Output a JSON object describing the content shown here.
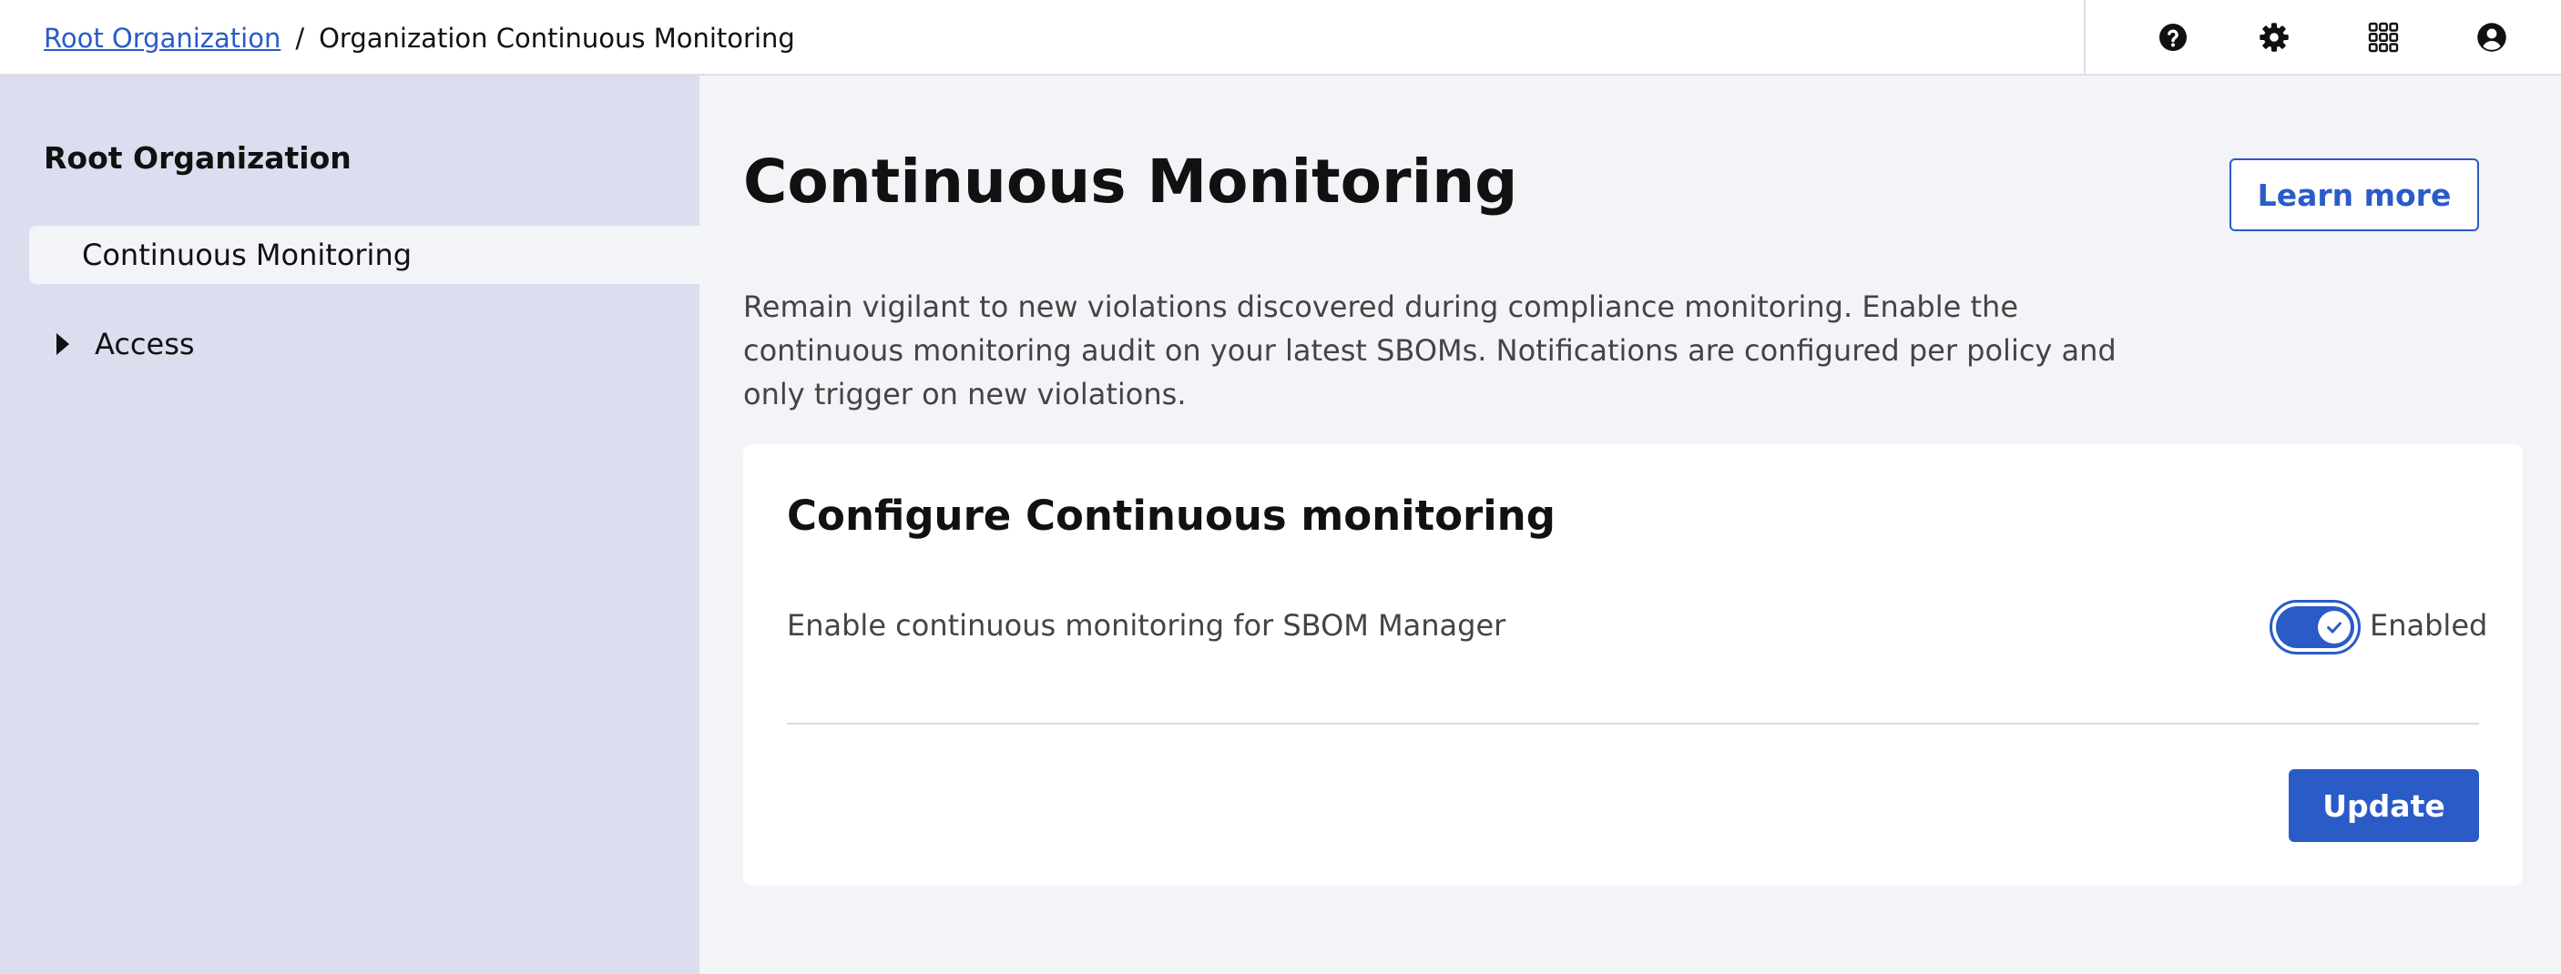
{
  "breadcrumb": {
    "root": "Root Organization",
    "separator": "/",
    "current": "Organization Continuous Monitoring"
  },
  "header_icons": [
    "help-icon",
    "gear-icon",
    "apps-grid-icon",
    "user-account-icon"
  ],
  "sidebar": {
    "title": "Root Organization",
    "items": [
      {
        "label": "Continuous Monitoring",
        "active": true
      },
      {
        "label": "Access",
        "expandable": true,
        "expanded": false
      }
    ]
  },
  "main": {
    "title": "Continuous Monitoring",
    "learn_more_label": "Learn more",
    "description": "Remain vigilant to new violations discovered during compliance monitoring. Enable the continuous monitoring audit on your latest SBOMs. Notifications are configured per policy and only trigger on new violations.",
    "card": {
      "title": "Configure Continuous monitoring",
      "setting_label": "Enable continuous monitoring for SBOM Manager",
      "toggle_checked": true,
      "toggle_text": "Enabled",
      "update_label": "Update"
    }
  },
  "colors": {
    "accent": "#2a5bc7",
    "sidebar_bg": "#dadeef",
    "page_bg": "#f3f4f8",
    "card_bg": "#ffffff"
  }
}
